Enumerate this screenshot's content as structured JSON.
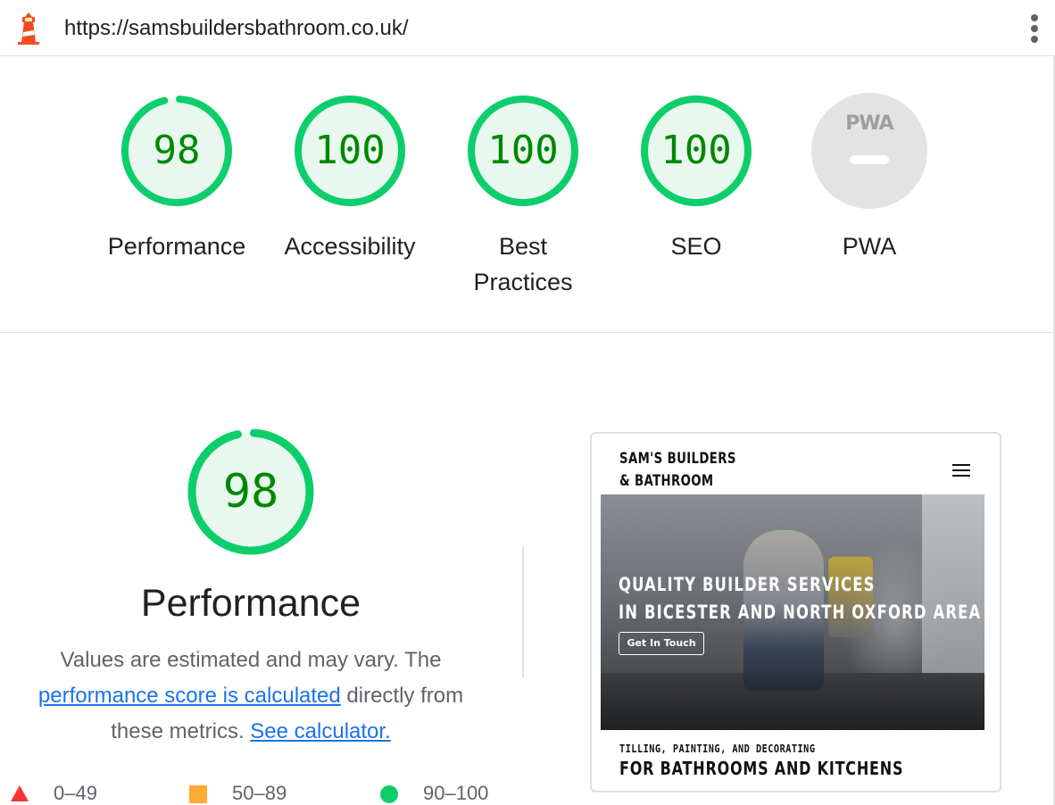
{
  "topbar": {
    "url": "https://samsbuildersbathroom.co.uk/",
    "logo_icon": "lighthouse-icon",
    "menu_icon": "more-vertical-icon"
  },
  "summary": {
    "gauges": [
      {
        "score": "98",
        "score_value": 98,
        "label": "Performance"
      },
      {
        "score": "100",
        "score_value": 100,
        "label": "Accessibility"
      },
      {
        "score": "100",
        "score_value": 100,
        "label": "Best Practices"
      },
      {
        "score": "100",
        "score_value": 100,
        "label": "SEO"
      }
    ],
    "pwa": {
      "badge_text": "PWA",
      "label": "PWA"
    }
  },
  "performance": {
    "score": "98",
    "score_value": 98,
    "title": "Performance",
    "desc_before": "Values are estimated and may vary. The ",
    "link_score": "performance score is calculated",
    "desc_middle": " directly from these metrics. ",
    "link_calc": "See calculator."
  },
  "legend": {
    "fail": "0–49",
    "average": "50–89",
    "pass": "90–100"
  },
  "screenshot": {
    "logo_line1": "SAM'S BUILDERS",
    "logo_line2": "& BATHROOM",
    "hero_line1": "QUALITY BUILDER SERVICES",
    "hero_line2": "IN BICESTER AND NORTH OXFORD AREA",
    "hero_button": "Get In Touch",
    "sub_small": "TILLING, PAINTING, AND DECORATING",
    "sub_big": "FOR BATHROOMS AND KITCHENS"
  },
  "colors": {
    "pass": "#0cce6b",
    "pass_text": "#008800",
    "pass_fill": "#e8f8ee",
    "average": "#ffaa33",
    "fail": "#ff3333",
    "link": "#1a73e8",
    "pwa_gray": "#e3e3e3"
  }
}
